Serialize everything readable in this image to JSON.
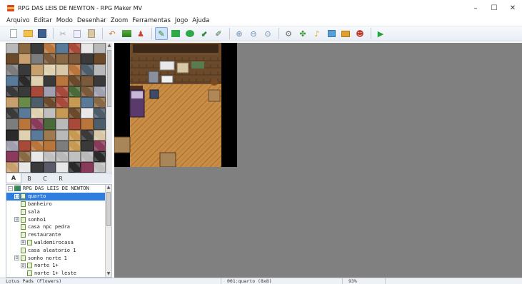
{
  "window": {
    "title": "RPG DAS LEIS DE NEWTON - RPG Maker MV",
    "controls": [
      "–",
      "☐",
      "✕"
    ]
  },
  "menu": [
    "Arquivo",
    "Editar",
    "Modo",
    "Desenhar",
    "Zoom",
    "Ferramentas",
    "Jogo",
    "Ajuda"
  ],
  "toolbar": {
    "icons": [
      "new-project-icon",
      "open-project-icon",
      "save-project-icon",
      "cut-icon",
      "copy-icon",
      "paste-icon",
      "undo-icon",
      "map-mode-icon",
      "event-mode-icon",
      "pencil-icon",
      "rectangle-icon",
      "ellipse-icon",
      "fill-icon",
      "shadow-pen-icon",
      "zoom-in-icon",
      "zoom-out-icon",
      "actual-size-icon",
      "database-icon",
      "plugin-manager-icon",
      "sound-test-icon",
      "event-searcher-icon",
      "resource-manager-icon",
      "character-generator-icon",
      "playtest-icon"
    ],
    "active_tool": "pencil-icon"
  },
  "tileset": {
    "tabs": [
      "A",
      "B",
      "C",
      "R"
    ],
    "selected_tab": "A"
  },
  "map_tree": {
    "project": "RPG DAS LEIS DE NEWTON",
    "items": [
      {
        "label": "quarto",
        "level": 1,
        "selected": true,
        "expander": "■"
      },
      {
        "label": "banheiro",
        "level": 2
      },
      {
        "label": "sala",
        "level": 2
      },
      {
        "label": "sonho1",
        "level": 1,
        "expander": "⊟"
      },
      {
        "label": "casa npc pedra",
        "level": 2
      },
      {
        "label": "restaurante",
        "level": 2
      },
      {
        "label": "waldemirocasa",
        "level": 2,
        "expander": "⊞"
      },
      {
        "label": "casa aleatorio 1",
        "level": 2
      },
      {
        "label": "sonho norte 1",
        "level": 1,
        "expander": "⊟"
      },
      {
        "label": "norte 1+",
        "level": 2,
        "expander": "⊟"
      },
      {
        "label": "norte 1+ leste",
        "level": 3
      }
    ]
  },
  "status": {
    "tileset_name": "Lotus Pads (Flowers)",
    "map_info": "001:quarto (8x8)",
    "zoom": "93%"
  },
  "colors": {
    "selection": "#2f7de0",
    "canvas_bg": "#808080",
    "toolbar_bg": "#e9eef5"
  }
}
